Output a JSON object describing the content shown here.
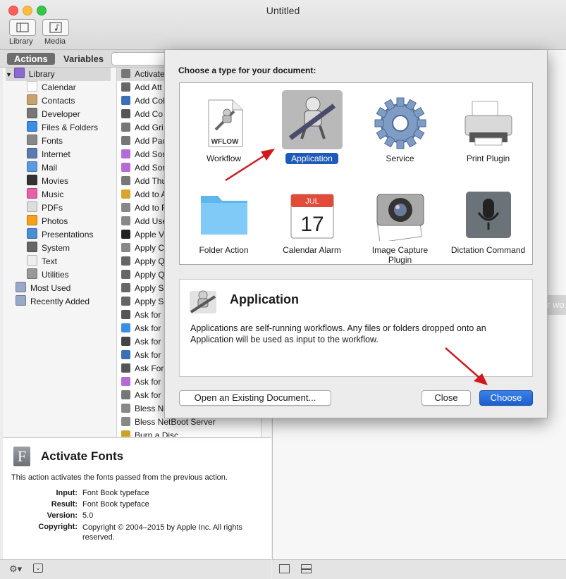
{
  "window": {
    "title": "Untitled"
  },
  "toolbar": {
    "library_label": "Library",
    "media_label": "Media"
  },
  "tabs": {
    "actions": "Actions",
    "variables": "Variables"
  },
  "library": [
    {
      "label": "Library",
      "icon": "library-icon",
      "indent": 0
    },
    {
      "label": "Calendar",
      "icon": "calendar-icon",
      "indent": 1
    },
    {
      "label": "Contacts",
      "icon": "contacts-icon",
      "indent": 1
    },
    {
      "label": "Developer",
      "icon": "developer-icon",
      "indent": 1
    },
    {
      "label": "Files & Folders",
      "icon": "finder-icon",
      "indent": 1
    },
    {
      "label": "Fonts",
      "icon": "fonts-icon",
      "indent": 1
    },
    {
      "label": "Internet",
      "icon": "internet-icon",
      "indent": 1
    },
    {
      "label": "Mail",
      "icon": "mail-icon",
      "indent": 1
    },
    {
      "label": "Movies",
      "icon": "movies-icon",
      "indent": 1
    },
    {
      "label": "Music",
      "icon": "music-icon",
      "indent": 1
    },
    {
      "label": "PDFs",
      "icon": "pdf-icon",
      "indent": 1
    },
    {
      "label": "Photos",
      "icon": "photos-icon",
      "indent": 1
    },
    {
      "label": "Presentations",
      "icon": "presentations-icon",
      "indent": 1
    },
    {
      "label": "System",
      "icon": "system-icon",
      "indent": 1
    },
    {
      "label": "Text",
      "icon": "text-icon",
      "indent": 1
    },
    {
      "label": "Utilities",
      "icon": "utilities-icon",
      "indent": 1
    },
    {
      "label": "Most Used",
      "icon": "folder-icon",
      "indent": 0
    },
    {
      "label": "Recently Added",
      "icon": "folder-icon",
      "indent": 0
    }
  ],
  "actions": [
    "Activate",
    "Add Att",
    "Add Col",
    "Add Co",
    "Add Gri",
    "Add Pac",
    "Add Son",
    "Add Son",
    "Add Thu",
    "Add to A",
    "Add to F",
    "Add Use",
    "Apple V",
    "Apply C",
    "Apply Q",
    "Apply Q",
    "Apply S",
    "Apply S",
    "Ask for",
    "Ask for",
    "Ask for",
    "Ask for",
    "Ask For",
    "Ask for",
    "Ask for",
    "Bless N",
    "Bless NetBoot Server",
    "Burn a Disc"
  ],
  "dialog": {
    "prompt": "Choose a type for your document:",
    "types": [
      {
        "label": "Workflow",
        "icon": "workflow-document-icon",
        "badge": "WFLOW",
        "selected": false
      },
      {
        "label": "Application",
        "icon": "automator-robot-icon",
        "selected": true
      },
      {
        "label": "Service",
        "icon": "gear-icon",
        "selected": false
      },
      {
        "label": "Print Plugin",
        "icon": "printer-icon",
        "selected": false
      },
      {
        "label": "Folder Action",
        "icon": "folder-icon",
        "selected": false
      },
      {
        "label": "Calendar Alarm",
        "icon": "calendar-icon",
        "month": "JUL",
        "day": "17",
        "selected": false
      },
      {
        "label": "Image Capture Plugin",
        "icon": "camera-icon",
        "selected": false
      },
      {
        "label": "Dictation Command",
        "icon": "microphone-icon",
        "selected": false
      }
    ],
    "detail_title": "Application",
    "detail_text": "Applications are self-running workflows. Any files or folders dropped onto an Application will be used as input to the workflow.",
    "open_existing": "Open an Existing Document...",
    "close": "Close",
    "choose": "Choose"
  },
  "description": {
    "title": "Activate Fonts",
    "summary": "This action activates the fonts passed from the previous action.",
    "input_label": "Input:",
    "input": "Font Book typeface",
    "result_label": "Result:",
    "result": "Font Book typeface",
    "version_label": "Version:",
    "version": "5.0",
    "copyright_label": "Copyright:",
    "copyright": "Copyright © 2004–2015 by Apple Inc. All rights reserved."
  },
  "right_pane": {
    "partial_text": "r wo"
  },
  "colors": {
    "accent": "#1e5bb8",
    "arrow": "#d0191f"
  }
}
